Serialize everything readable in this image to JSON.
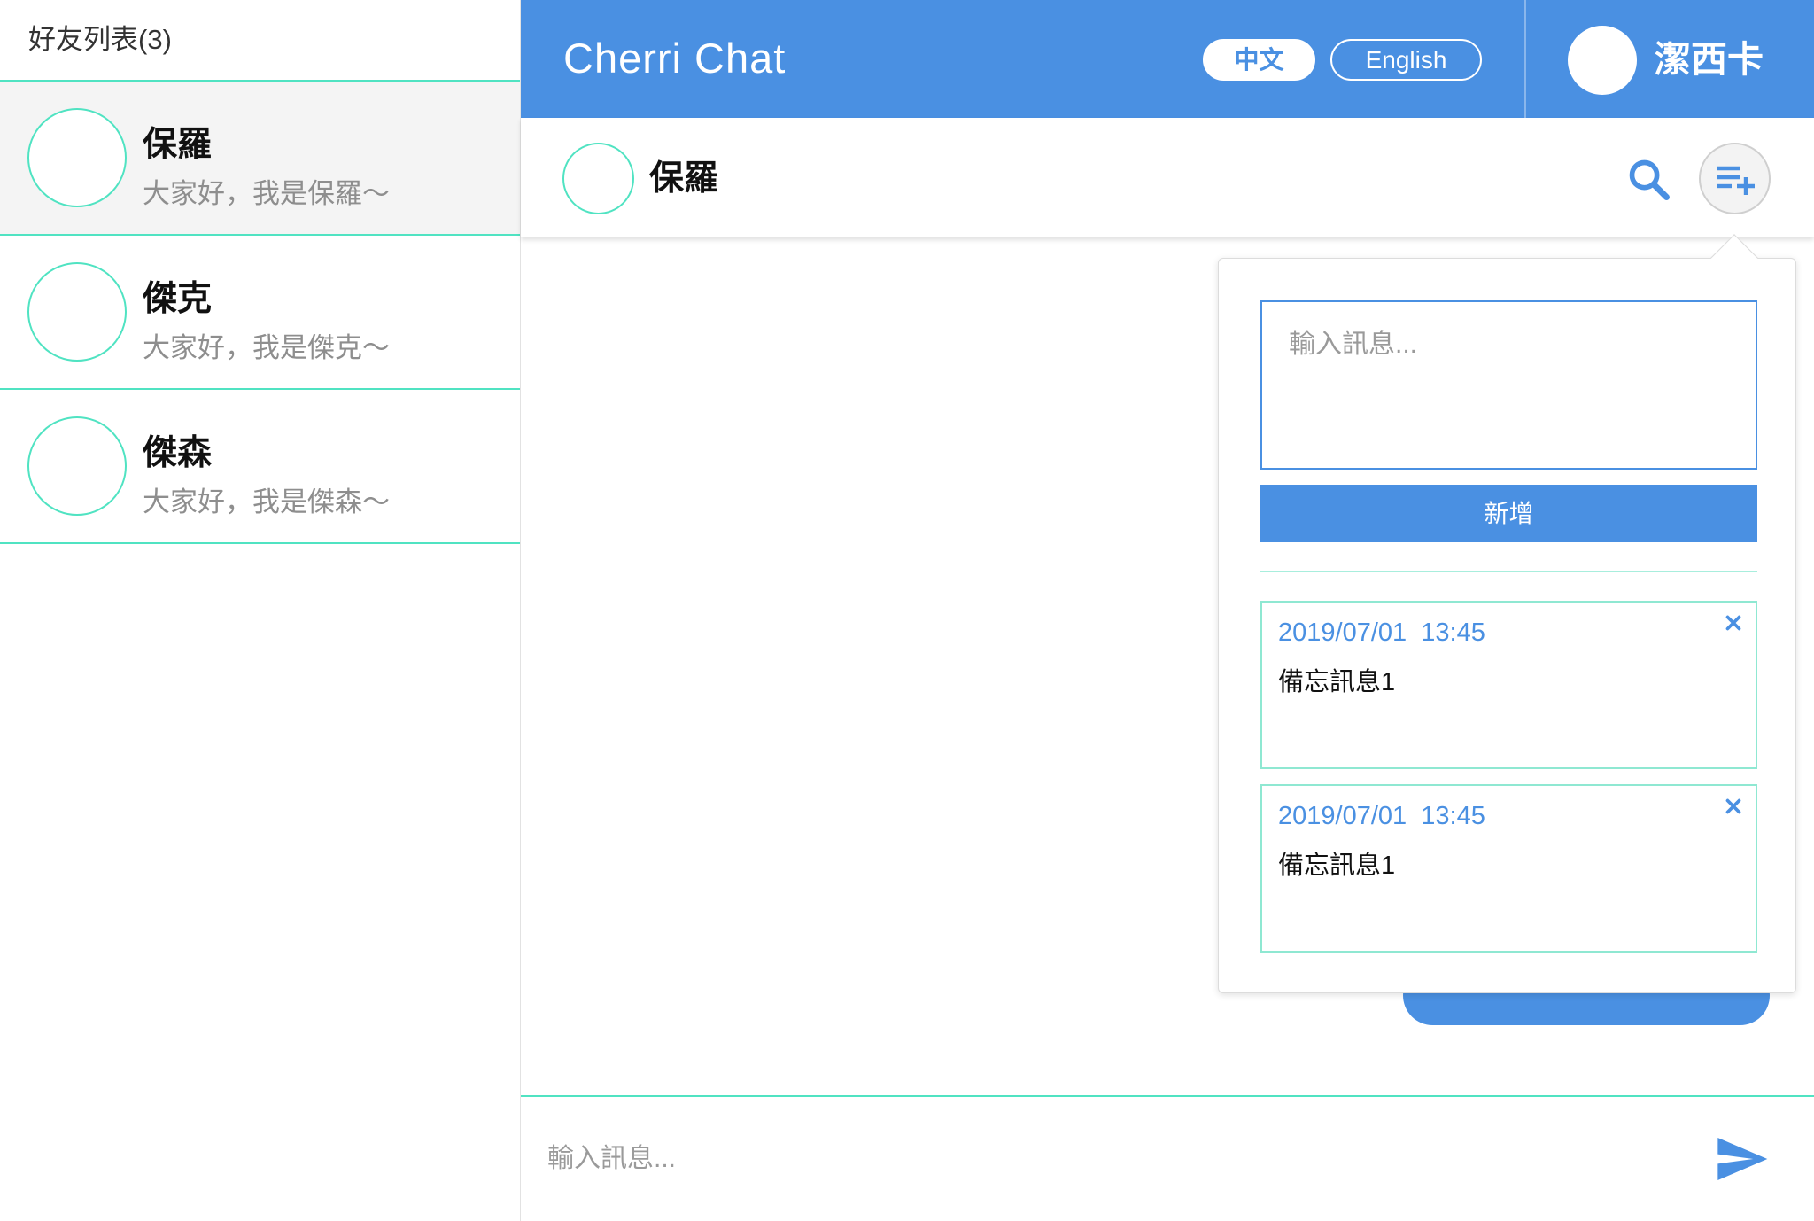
{
  "sidebar": {
    "title": "好友列表(3)",
    "friends": [
      {
        "name": "保羅",
        "status": "大家好，我是保羅～"
      },
      {
        "name": "傑克",
        "status": "大家好，我是傑克～"
      },
      {
        "name": "傑森",
        "status": "大家好，我是傑森～"
      }
    ]
  },
  "header": {
    "app_title": "Cherri Chat",
    "lang_zh": "中文",
    "lang_en": "English",
    "user_name": "潔西卡"
  },
  "chat": {
    "contact_name": "保羅",
    "input_placeholder": "輸入訊息..."
  },
  "memo_panel": {
    "input_placeholder": "輸入訊息...",
    "add_label": "新增",
    "items": [
      {
        "time": "2019/07/01  13:45",
        "text": "備忘訊息1"
      },
      {
        "time": "2019/07/01  13:45",
        "text": "備忘訊息1"
      }
    ]
  },
  "icons": {
    "search": "search-icon",
    "memo_add": "playlist-add-icon",
    "send": "send-icon",
    "close": "close-icon"
  },
  "colors": {
    "primary": "#4a90e2",
    "accent": "#50e3c2",
    "muted_text": "#8e8e8e",
    "selected_row": "#f4f4f4"
  }
}
